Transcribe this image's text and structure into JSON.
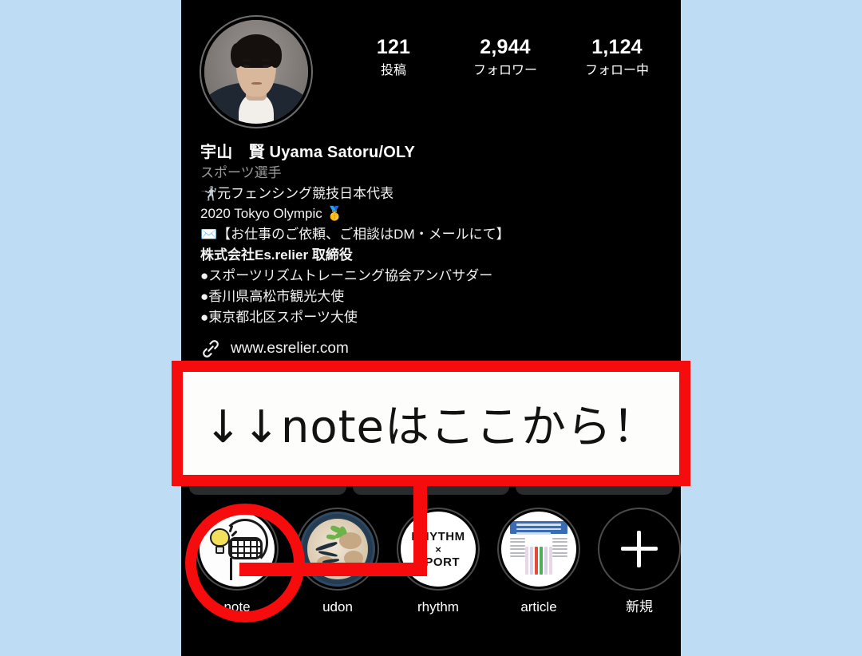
{
  "background_color": "#bfdcf5",
  "app": {
    "name": "Instagram Profile",
    "panel_background": "#000000"
  },
  "profile": {
    "avatar": "user-profile-photo",
    "display_name": "宇山　賢 Uyama Satoru/OLY",
    "category": "スポーツ選手",
    "stats": [
      {
        "value": "121",
        "label": "投稿"
      },
      {
        "value": "2,944",
        "label": "フォロワー"
      },
      {
        "value": "1,124",
        "label": "フォロー中"
      }
    ],
    "bio_lines": [
      {
        "text": "🤺元フェンシング競技日本代表",
        "bold": false
      },
      {
        "text": "2020 Tokyo Olympic 🥇",
        "bold": false
      },
      {
        "text": "✉️【お仕事のご依頼、ご相談はDM・メールにて】",
        "bold": false
      },
      {
        "text": "株式会社Es.relier 取締役",
        "bold": true
      },
      {
        "text": "●スポーツリズムトレーニング協会アンバサダー",
        "bold": false
      },
      {
        "text": "●香川県高松市観光大使",
        "bold": false
      },
      {
        "text": "●東京都北区スポーツ大使",
        "bold": false
      }
    ],
    "website": {
      "icon": "link-icon",
      "url": "www.esrelier.com"
    }
  },
  "highlights": [
    {
      "label": "note",
      "cover": "lightbulb-and-racket-cover",
      "circled": true
    },
    {
      "label": "udon",
      "cover": "udon-noodle-bowl-photo",
      "circled": false
    },
    {
      "label": "rhythm",
      "cover": "rhythm-x-sport-text-cover",
      "circled": false
    },
    {
      "label": "article",
      "cover": "document-table-screenshot",
      "circled": false
    },
    {
      "label": "新規",
      "cover": "plus-icon",
      "circled": false
    }
  ],
  "rhythm_cover": {
    "line1": "RHYTHM",
    "line2": "×",
    "line3": "SPORT"
  },
  "annotation": {
    "banner_text": "↓↓noteはここから！",
    "accent_color": "#f60c0c",
    "banner_background": "#fdfdfb",
    "text_color": "#121212",
    "circle_target": "note",
    "connector": "elbow-line-from-banner-to-note-highlight"
  }
}
